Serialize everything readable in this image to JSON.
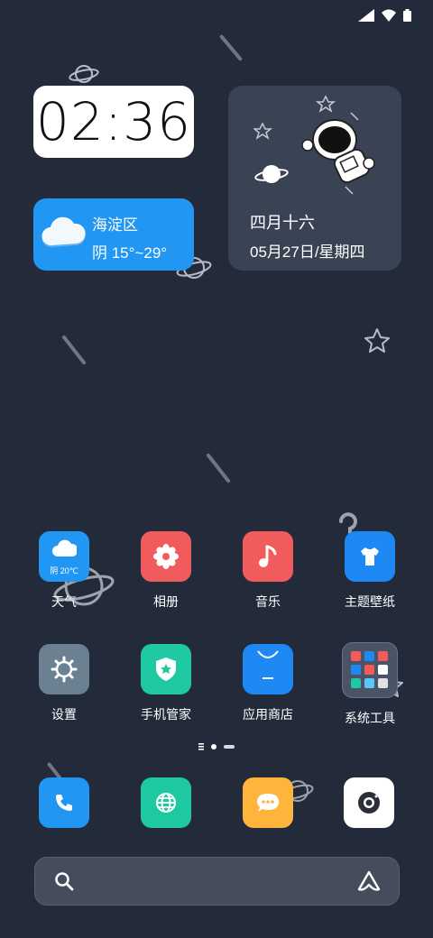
{
  "clock": {
    "time": "02:36"
  },
  "weather_widget": {
    "location": "海淀区",
    "condition_temp": "阴 15°~29°"
  },
  "calendar_widget": {
    "lunar_date": "四月十六",
    "date_weekday": "05月27日/星期四"
  },
  "apps_row1": [
    {
      "label": "天气",
      "icon": "weather-icon",
      "badge": "阴 20℃",
      "color": "#2196f3"
    },
    {
      "label": "相册",
      "icon": "flower-icon",
      "color": "#f25b5b"
    },
    {
      "label": "音乐",
      "icon": "music-note-icon",
      "color": "#f25b5b"
    },
    {
      "label": "主题壁纸",
      "icon": "tshirt-icon",
      "color": "#1e88f5"
    }
  ],
  "apps_row2": [
    {
      "label": "设置",
      "icon": "gear-icon",
      "color": "#6b8090"
    },
    {
      "label": "手机管家",
      "icon": "shield-star-icon",
      "color": "#1ec8a0"
    },
    {
      "label": "应用商店",
      "icon": "shopping-bag-icon",
      "color": "#1e88f5"
    },
    {
      "label": "系统工具",
      "icon": "folder-grid-icon",
      "color": "#4a5466"
    }
  ],
  "dock": [
    {
      "icon": "phone-icon",
      "color": "#2196f3"
    },
    {
      "icon": "globe-icon",
      "color": "#1ec8a0"
    },
    {
      "icon": "message-icon",
      "color": "#ffb43c"
    },
    {
      "icon": "camera-icon",
      "color": "#ffffff"
    }
  ],
  "page_indicator": {
    "pages": 3,
    "current": 2
  },
  "search_bar": {
    "left_icon": "search-icon",
    "right_icon": "assistant-icon"
  }
}
